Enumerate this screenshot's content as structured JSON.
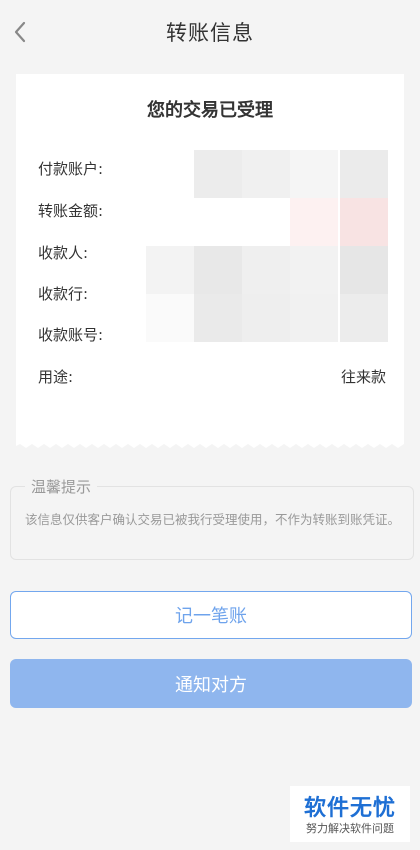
{
  "header": {
    "title": "转账信息",
    "back_icon": "chevron-left-icon"
  },
  "receipt": {
    "title": "您的交易已受理",
    "rows": [
      {
        "label": "付款账户:",
        "value": ""
      },
      {
        "label": "转账金额:",
        "value": ""
      },
      {
        "label": "收款人:",
        "value": ""
      },
      {
        "label": "收款行:",
        "value": ""
      },
      {
        "label": "收款账号:",
        "value": ""
      },
      {
        "label": "用途:",
        "value": "往来款"
      }
    ]
  },
  "tip": {
    "title": "温馨提示",
    "text": "该信息仅供客户确认交易已被我行受理使用，不作为转账到账凭证。"
  },
  "buttons": {
    "record_label": "记一笔账",
    "notify_label": "通知对方"
  },
  "watermark": {
    "main": "软件无忧",
    "sub": "努力解决软件问题"
  },
  "colors": {
    "accent": "#6ea3ec",
    "accent_fill": "#8fb6ee",
    "background": "#f4f4f4"
  }
}
